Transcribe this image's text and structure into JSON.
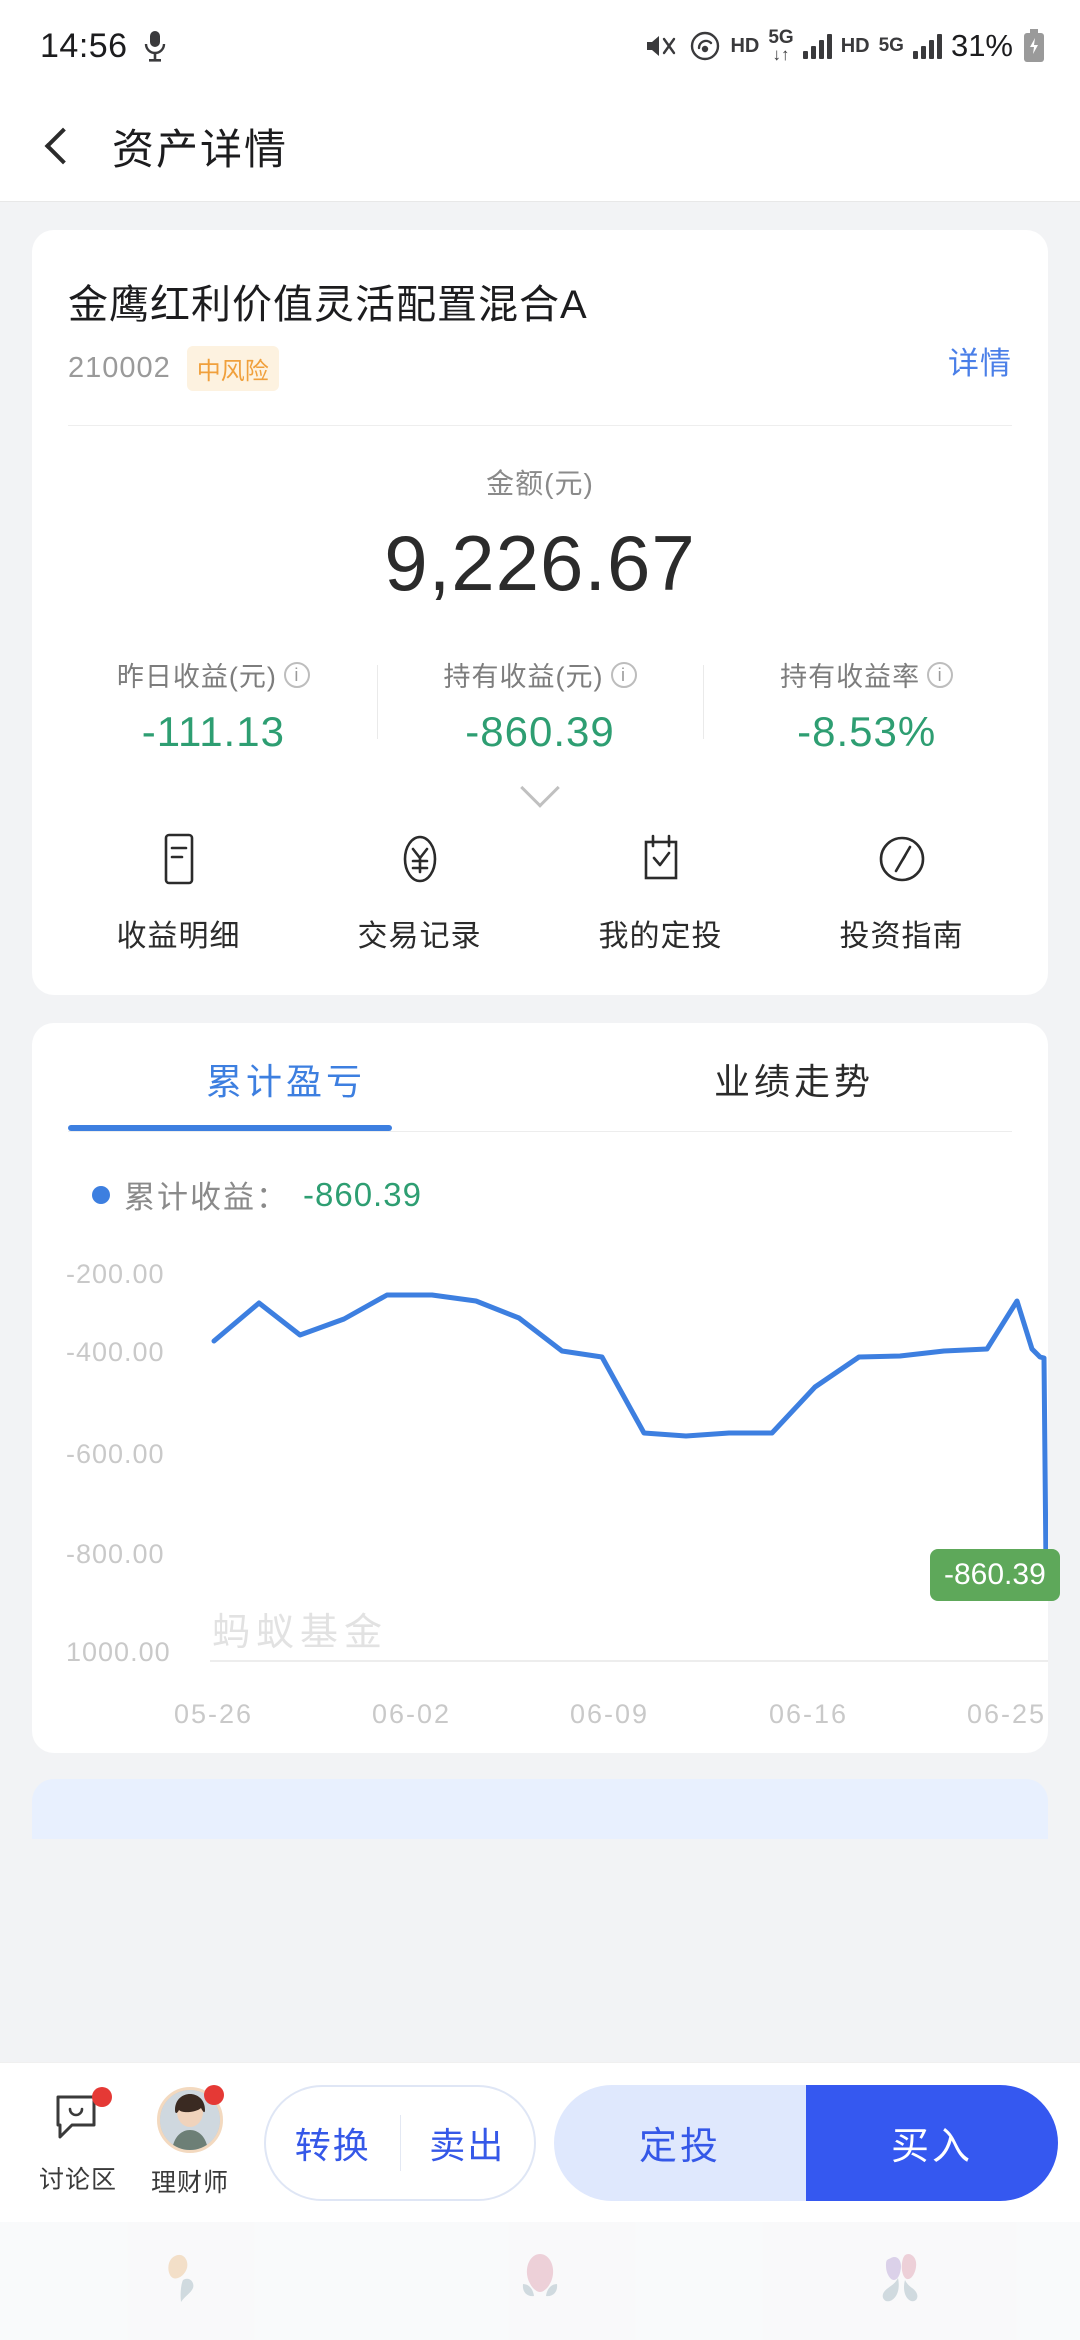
{
  "statusbar": {
    "time": "14:56",
    "mic_icon": "microphone-icon",
    "mute_icon": "mute-icon",
    "hotspot_icon": "hotspot-icon",
    "hd1": "HD",
    "net1": "5G",
    "net1_arrows": "↓↑",
    "hd2": "HD",
    "net2": "5G",
    "battery": "31%",
    "battery_icon": "battery-charging-icon"
  },
  "nav": {
    "back_icon": "back-chevron-icon",
    "title": "资产详情"
  },
  "fund": {
    "name": "金鹰红利价值灵活配置混合A",
    "code": "210002",
    "risk_badge": "中风险",
    "detail_link": "详情",
    "amount_label": "金额(元)",
    "amount_value": "9,226.67",
    "metrics": [
      {
        "label": "昨日收益(元)",
        "value": "-111.13",
        "info_icon": "info-icon"
      },
      {
        "label": "持有收益(元)",
        "value": "-860.39",
        "info_icon": "info-icon"
      },
      {
        "label": "持有收益率",
        "value": "-8.53%",
        "info_icon": "info-icon"
      }
    ],
    "expand_icon": "chevron-down-icon"
  },
  "quick_actions": [
    {
      "label": "收益明细",
      "icon": "document-icon"
    },
    {
      "label": "交易记录",
      "icon": "yen-oval-icon"
    },
    {
      "label": "我的定投",
      "icon": "calendar-check-icon"
    },
    {
      "label": "投资指南",
      "icon": "compass-icon"
    }
  ],
  "chart_panel": {
    "tabs": [
      {
        "label": "累计盈亏",
        "active": true
      },
      {
        "label": "业绩走势",
        "active": false
      }
    ],
    "legend_label": "累计收益：",
    "legend_value": "-860.39",
    "watermark": "蚂蚁基金",
    "tooltip_value": "-860.39"
  },
  "chart_data": {
    "type": "line",
    "title": "累计盈亏",
    "series_name": "累计收益",
    "xlabel": "",
    "ylabel": "",
    "ylim": [
      -1000,
      -100
    ],
    "grid": false,
    "legend_position": "top-left",
    "line_color": "#3d7fe0",
    "x_ticks": [
      "05-26",
      "06-02",
      "06-09",
      "06-16",
      "06-25"
    ],
    "y_ticks": [
      "-200.00",
      "-400.00",
      "-600.00",
      "-800.00",
      "1000.00"
    ],
    "x": [
      "05-26",
      "05-27",
      "05-28",
      "05-29",
      "05-30",
      "06-02",
      "06-03",
      "06-04",
      "06-05",
      "06-06",
      "06-09",
      "06-10",
      "06-11",
      "06-12",
      "06-13",
      "06-16",
      "06-17",
      "06-18",
      "06-19",
      "06-20",
      "06-23",
      "06-24",
      "06-25",
      "06-26"
    ],
    "values": [
      -358,
      -290,
      -400,
      -350,
      -288,
      -288,
      -300,
      -340,
      -420,
      -430,
      -700,
      -710,
      -700,
      -700,
      -560,
      -452,
      -450,
      -440,
      -430,
      -300,
      -400,
      -440,
      -445,
      -860.39
    ],
    "end_marker": {
      "label": "-860.39",
      "value": -860.39
    }
  },
  "bottombar": {
    "icons": [
      {
        "label": "讨论区",
        "icon": "chat-bubble-icon",
        "badge": true
      },
      {
        "label": "理财师",
        "icon": "advisor-avatar",
        "badge": true
      }
    ],
    "convert_label": "转换",
    "sell_label": "卖出",
    "plan_label": "定投",
    "buy_label": "买入"
  },
  "gesture_nav": {
    "items": [
      "flower-orange-icon",
      "flower-pink-icon",
      "flower-tulip-icon"
    ]
  }
}
